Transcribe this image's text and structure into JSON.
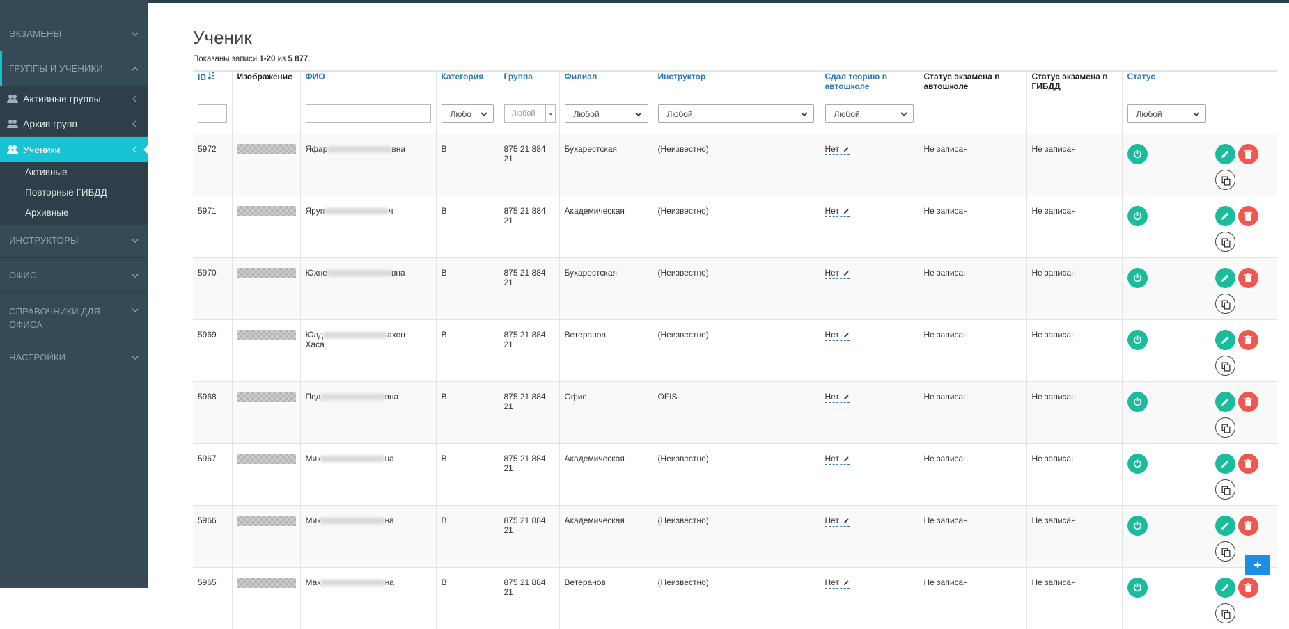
{
  "sidebar": {
    "sections": [
      {
        "label": "ЭКЗАМЕНЫ"
      },
      {
        "label": "ГРУППЫ И УЧЕНИКИ"
      },
      {
        "label": "ИНСТРУКТОРЫ"
      },
      {
        "label": "ОФИС"
      },
      {
        "label": "СПРАВОЧНИКИ ДЛЯ ОФИСА"
      },
      {
        "label": "НАСТРОЙКИ"
      }
    ],
    "items": [
      {
        "label": "Активные группы",
        "icon": "users-icon"
      },
      {
        "label": "Архив групп",
        "icon": "users-icon"
      },
      {
        "label": "Ученики",
        "icon": "users-icon"
      }
    ],
    "subitems": [
      {
        "label": "Активные"
      },
      {
        "label": "Повторные ГИБДД"
      },
      {
        "label": "Архивные"
      }
    ]
  },
  "page": {
    "title": "Ученик",
    "summary_prefix": "Показаны записи ",
    "summary_range": "1-20",
    "summary_mid": " из ",
    "summary_total": "5 877",
    "summary_suffix": "."
  },
  "columns": [
    {
      "label": "ID",
      "sortable": true
    },
    {
      "label": "Изображение",
      "sortable": false
    },
    {
      "label": "ФИО",
      "sortable": true
    },
    {
      "label": "Категория",
      "sortable": true
    },
    {
      "label": "Группа",
      "sortable": true
    },
    {
      "label": "Филиал",
      "sortable": true
    },
    {
      "label": "Инструктор",
      "sortable": true
    },
    {
      "label": "Сдал теорию в автошколе",
      "sortable": true
    },
    {
      "label": "Статус экзамена в автошколе",
      "sortable": false
    },
    {
      "label": "Статус экзамена в ГИБДД",
      "sortable": false
    },
    {
      "label": "Статус",
      "sortable": true
    },
    {
      "label": "",
      "sortable": false
    }
  ],
  "filters": {
    "category": "Любо",
    "group_placeholder": "Любой",
    "branch": "Любой",
    "instructor": "Любой",
    "theory": "Любой",
    "status": "Любой"
  },
  "rows": [
    {
      "id": "5972",
      "name_start": "Яфар",
      "name_end": "вна",
      "name_line2": "",
      "category": "В",
      "group": "875 21 884 21",
      "branch": "Бухарестская",
      "instructor": "(Неизвестно)",
      "theory": "Нет",
      "school_exam": "Не записан",
      "gibdd_exam": "Не записан"
    },
    {
      "id": "5971",
      "name_start": "Яруп",
      "name_end": "ч",
      "name_line2": "",
      "category": "В",
      "group": "875 21 884 21",
      "branch": "Академическая",
      "instructor": "(Неизвестно)",
      "theory": "Нет",
      "school_exam": "Не записан",
      "gibdd_exam": "Не записан"
    },
    {
      "id": "5970",
      "name_start": "Юхне",
      "name_end": "вна",
      "name_line2": "",
      "category": "В",
      "group": "875 21 884 21",
      "branch": "Бухарестская",
      "instructor": "(Неизвестно)",
      "theory": "Нет",
      "school_exam": "Не записан",
      "gibdd_exam": "Не записан"
    },
    {
      "id": "5969",
      "name_start": "Юлд",
      "name_end": "ахон",
      "name_line2": "Хаса",
      "category": "В",
      "group": "875 21 884 21",
      "branch": "Ветеранов",
      "instructor": "(Неизвестно)",
      "theory": "Нет",
      "school_exam": "Не записан",
      "gibdd_exam": "Не записан"
    },
    {
      "id": "5968",
      "name_start": "Под",
      "name_end": "вна",
      "name_line2": "",
      "category": "В",
      "group": "875 21 884 21",
      "branch": "Офис",
      "instructor": "OFIS",
      "theory": "Нет",
      "school_exam": "Не записан",
      "gibdd_exam": "Не записан"
    },
    {
      "id": "5967",
      "name_start": "Мик",
      "name_end": "на",
      "name_line2": "",
      "category": "В",
      "group": "875 21 884 21",
      "branch": "Академическая",
      "instructor": "(Неизвестно)",
      "theory": "Нет",
      "school_exam": "Не записан",
      "gibdd_exam": "Не записан"
    },
    {
      "id": "5966",
      "name_start": "Мик",
      "name_end": "на",
      "name_line2": "",
      "category": "В",
      "group": "875 21 884 21",
      "branch": "Академическая",
      "instructor": "(Неизвестно)",
      "theory": "Нет",
      "school_exam": "Не записан",
      "gibdd_exam": "Не записан"
    },
    {
      "id": "5965",
      "name_start": "Мак",
      "name_end": "на",
      "name_line2": "",
      "category": "В",
      "group": "875 21 884 21",
      "branch": "Ветеранов",
      "instructor": "(Неизвестно)",
      "theory": "Нет",
      "school_exam": "Не записан",
      "gibdd_exam": "Не записан"
    }
  ],
  "colors": {
    "sidebar": "#364a55",
    "accent": "#18c3d6",
    "teal": "#1abc9c",
    "red": "#f0574f",
    "link": "#2a7ab8",
    "fab": "#1c8ee6"
  }
}
